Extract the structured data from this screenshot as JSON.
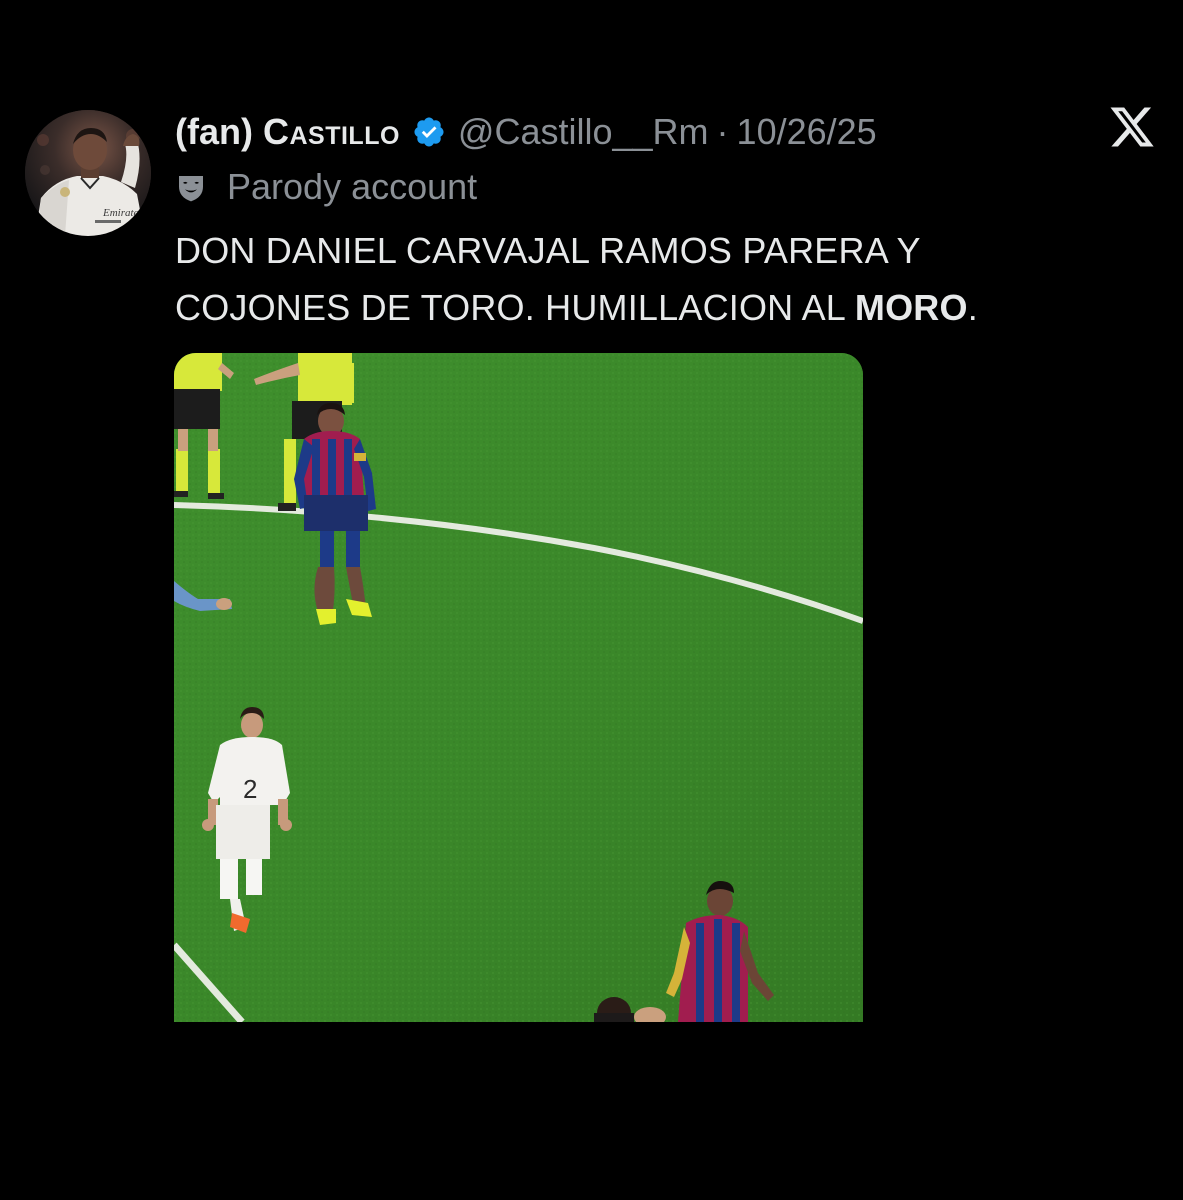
{
  "tweet": {
    "display_name_prefix": "(fan) ",
    "display_name_main": "Castillo",
    "handle": "@Castillo__Rm",
    "separator": "·",
    "date": "10/26/25",
    "account_label": "Parody account",
    "text_line_1": "DON DANIEL CARVAJAL RAMOS PARERA Y",
    "text_line_2_start": "COJONES DE TORO. HUMILLACION AL ",
    "text_line_2_bold": "MORO",
    "text_line_2_end": ".",
    "avatar_jersey_text": "Emirates"
  },
  "icons": {
    "verified": "verified-badge-icon",
    "parody": "parody-mask-icon",
    "brand": "x-logo-icon"
  },
  "media": {
    "player_number": "2"
  },
  "colors": {
    "background": "#000000",
    "text_primary": "#e7e9ea",
    "text_secondary": "#8b9096",
    "verified_blue": "#1d9bf0",
    "pitch_green": "#3d8a2a"
  }
}
